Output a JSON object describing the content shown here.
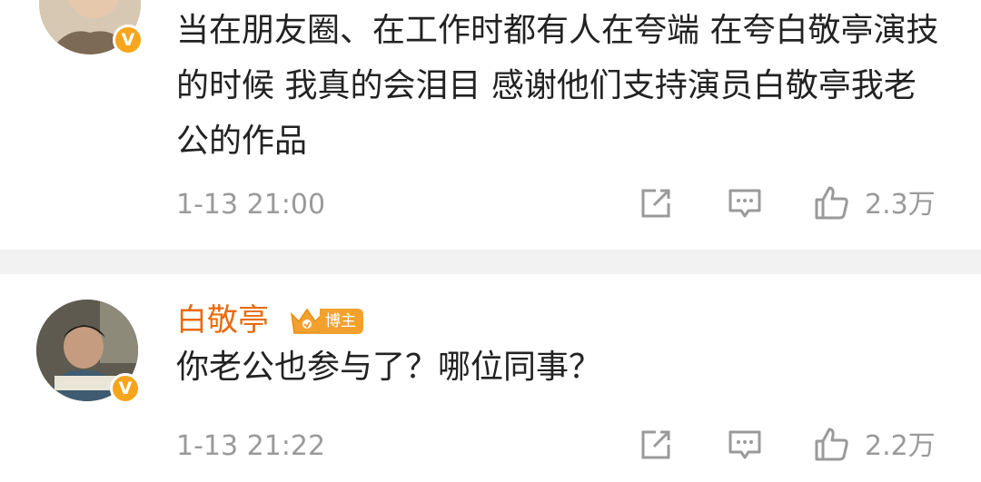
{
  "comments": [
    {
      "text": "当在朋友圈、在工作时都有人在夸端  在夸白敬亭演技的时候  我真的会泪目  感谢他们支持演员白敬亭我老公的作品",
      "time": "1-13 21:00",
      "likes": "2.3万",
      "verified_badge": "V"
    },
    {
      "username": "白敬亭",
      "badge_label": "博主",
      "text": "你老公也参与了？哪位同事？",
      "time": "1-13 21:22",
      "likes": "2.2万",
      "verified_badge": "V"
    }
  ],
  "colors": {
    "username": "#e86b0f",
    "meta_gray": "#9a9a9a",
    "badge_orange": "#f7a51c"
  },
  "icons": [
    "share-icon",
    "comment-icon",
    "like-icon",
    "crown-icon",
    "verified-icon"
  ]
}
